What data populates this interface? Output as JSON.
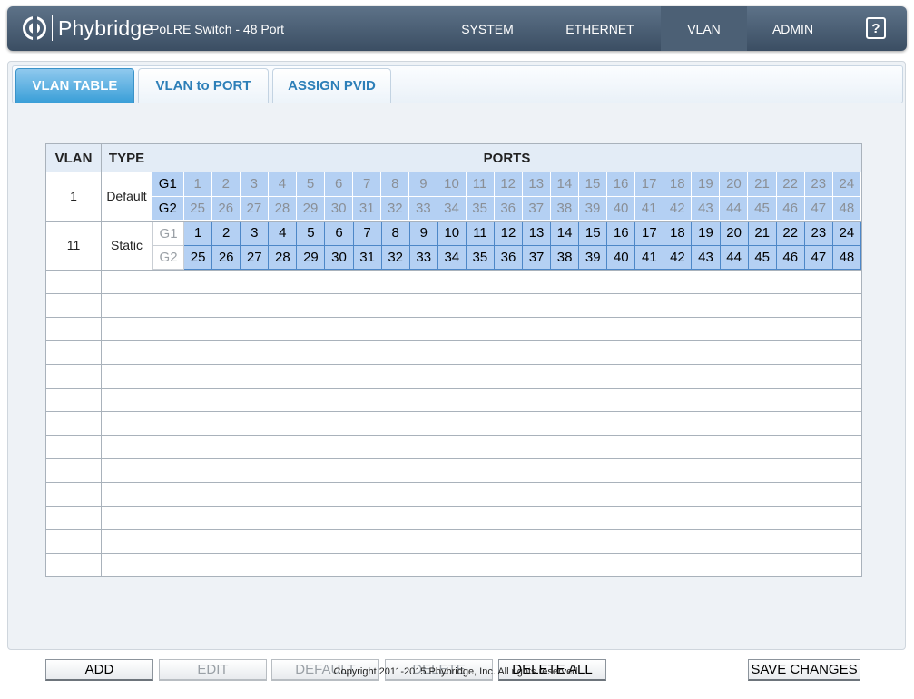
{
  "header": {
    "brand": "Phybridge",
    "product": "PoLRE Switch - 48 Port",
    "nav": [
      "SYSTEM",
      "ETHERNET",
      "VLAN",
      "ADMIN"
    ],
    "active_nav": "VLAN",
    "help": "?"
  },
  "tabs": [
    {
      "label": "VLAN TABLE",
      "active": true
    },
    {
      "label": "VLAN to PORT",
      "active": false
    },
    {
      "label": "ASSIGN PVID",
      "active": false
    }
  ],
  "table": {
    "headers": {
      "vlan": "VLAN",
      "type": "TYPE",
      "ports": "PORTS"
    },
    "group_labels": [
      "G1",
      "G2"
    ],
    "g1_ports": [
      "1",
      "2",
      "3",
      "4",
      "5",
      "6",
      "7",
      "8",
      "9",
      "10",
      "11",
      "12",
      "13",
      "14",
      "15",
      "16",
      "17",
      "18",
      "19",
      "20",
      "21",
      "22",
      "23",
      "24"
    ],
    "g2_ports": [
      "25",
      "26",
      "27",
      "28",
      "29",
      "30",
      "31",
      "32",
      "33",
      "34",
      "35",
      "36",
      "37",
      "38",
      "39",
      "40",
      "41",
      "42",
      "43",
      "44",
      "45",
      "46",
      "47",
      "48"
    ],
    "rows": [
      {
        "vlan": "1",
        "type": "Default"
      },
      {
        "vlan": "11",
        "type": "Static"
      }
    ],
    "empty_rows": 13
  },
  "buttons": {
    "add": "ADD",
    "edit": "EDIT",
    "default": "DEFAULT",
    "delete": "DELETE",
    "delete_all": "DELETE ALL",
    "save_changes": "SAVE CHANGES"
  },
  "footer": "Copyright 2011-2015 Phybridge, Inc. All rights reserved."
}
